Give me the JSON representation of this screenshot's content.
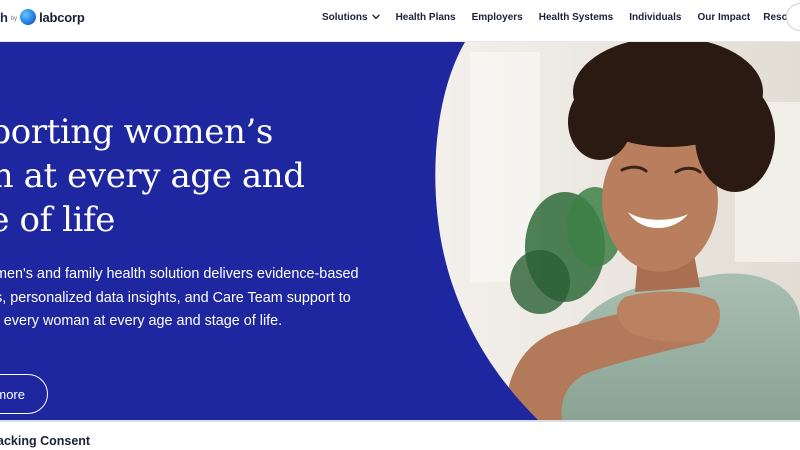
{
  "header": {
    "brand_prefix": "h",
    "brand_by": "by",
    "brand_name": "labcorp",
    "nav": [
      {
        "label": "Solutions"
      },
      {
        "label": "Health Plans"
      },
      {
        "label": "Employers"
      },
      {
        "label": "Health Systems"
      },
      {
        "label": "Individuals"
      },
      {
        "label": "Our Impact"
      },
      {
        "label": "Resources"
      }
    ]
  },
  "hero": {
    "title_lines": [
      "pporting women’s",
      "lth at every age and",
      "ge of life"
    ],
    "description_lines": [
      "men's and family health solution delivers evidence-based",
      "s, personalized data insights, and Care Team support to",
      "r every woman at every age and stage of life."
    ],
    "cta_label": "more",
    "panel_color": "#1f27a0"
  },
  "consent": {
    "title": "acking Consent"
  },
  "icons": {
    "solutions_dropdown": "chevron-down-icon",
    "logo": "labcorp-logo-icon"
  }
}
